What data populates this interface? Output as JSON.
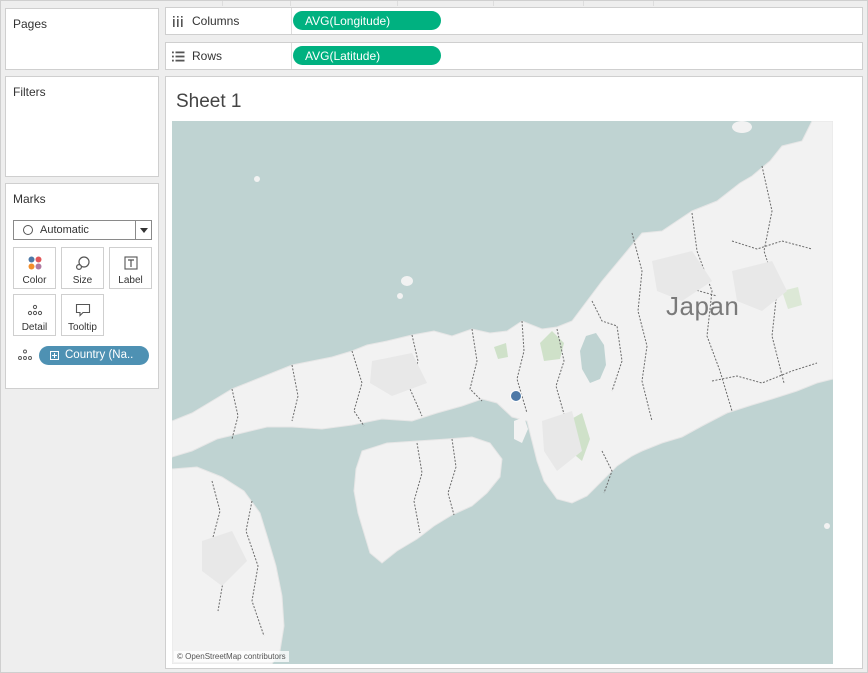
{
  "cards": {
    "pages_title": "Pages",
    "filters_title": "Filters",
    "marks_title": "Marks"
  },
  "marks": {
    "type": "Automatic",
    "buttons": {
      "color": "Color",
      "size": "Size",
      "label": "Label",
      "detail": "Detail",
      "tooltip": "Tooltip"
    },
    "detail_pill": "Country (Na.."
  },
  "shelves": {
    "columns_label": "Columns",
    "columns_pill": "AVG(Longitude)",
    "rows_label": "Rows",
    "rows_pill": "AVG(Latitude)"
  },
  "sheet": {
    "title": "Sheet 1",
    "map_label": "Japan",
    "attribution": "© OpenStreetMap contributors"
  },
  "colors": {
    "measure_pill": "#00b180",
    "dimension_pill": "#4e91b3",
    "mark_point": "#4e79a7",
    "water": "#bfd3d2",
    "land": "#f2f2f2"
  }
}
